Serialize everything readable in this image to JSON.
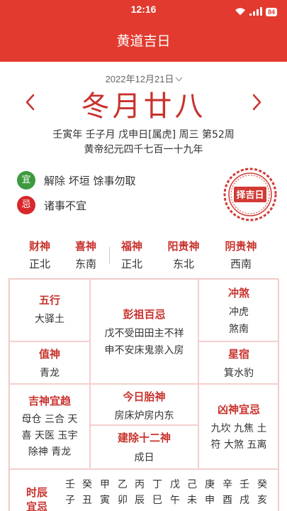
{
  "status": {
    "time": "12:16",
    "battery": "84"
  },
  "header": {
    "title": "黄道吉日"
  },
  "date": {
    "gregorian": "2022年12月21日",
    "lunar": "冬月廿八",
    "ganzhi": "壬寅年 壬子月 戊申日[属虎] 周三 第52周",
    "huangdi": "黄帝纪元四千七百一十九年"
  },
  "yiji": {
    "yi_badge": "宜",
    "yi_text": "解除 坏垣 馀事勿取",
    "ji_badge": "忌",
    "ji_text": "诸事不宜",
    "seal_text": "择吉日"
  },
  "gods": [
    {
      "name": "财神",
      "dir": "正北"
    },
    {
      "name": "喜神",
      "dir": "东南"
    },
    {
      "name": "福神",
      "dir": "正北"
    },
    {
      "name": "阳贵神",
      "dir": "东北"
    },
    {
      "name": "阴贵神",
      "dir": "西南"
    }
  ],
  "almanac": {
    "wuxing": {
      "title": "五行",
      "body": "大驿土"
    },
    "zhishen": {
      "title": "值神",
      "body": "青龙"
    },
    "pengzu": {
      "title": "彭祖百忌",
      "line1": "戊不受田田主不祥",
      "line2": "申不安床鬼祟入房"
    },
    "chongsha": {
      "title": "冲煞",
      "line1": "冲虎",
      "line2": "煞南"
    },
    "xingxiu": {
      "title": "星宿",
      "body": "箕水豹"
    },
    "jishen": {
      "title": "吉神宜趋",
      "line1": "母仓 三合 天",
      "line2": "喜 天医 玉宇",
      "line3": "除神 青龙"
    },
    "taishen": {
      "title": "今日胎神",
      "body": "房床炉房内东"
    },
    "jianchu": {
      "title": "建除十二神",
      "body": "成日"
    },
    "xiongshen": {
      "title": "凶神宜忌",
      "line1": "九坎 九焦 土",
      "line2": "符 大煞 五离"
    },
    "shichen": {
      "title": "时辰宜忌",
      "columns": [
        [
          "壬",
          "子"
        ],
        [
          "癸",
          "丑"
        ],
        [
          "甲",
          "寅"
        ],
        [
          "乙",
          "卯"
        ],
        [
          "丙",
          "辰"
        ],
        [
          "丁",
          "巳"
        ],
        [
          "戊",
          "午"
        ],
        [
          "己",
          "未"
        ],
        [
          "庚",
          "申"
        ],
        [
          "辛",
          "酉"
        ],
        [
          "壬",
          "戌"
        ],
        [
          "癸",
          "亥"
        ]
      ]
    }
  },
  "colors": {
    "brand_red": "#e23a2e",
    "accent_red": "#c8332d",
    "yi_green": "#3c9a3f",
    "ji_red": "#d8282b"
  },
  "icons": {
    "wifi": "wifi-icon",
    "signal": "signal-icon",
    "battery": "battery-icon",
    "prev": "chevron-left-icon",
    "next": "chevron-right-icon",
    "seal": "seal-icon"
  }
}
